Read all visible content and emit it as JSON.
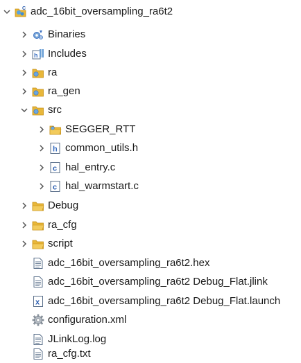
{
  "tree": {
    "root": {
      "label": "adc_16bit_oversampling_ra6t2",
      "icon": "c-project-icon",
      "expanded": true
    },
    "binaries": {
      "label": "Binaries",
      "icon": "binaries-icon"
    },
    "includes": {
      "label": "Includes",
      "icon": "includes-icon"
    },
    "ra": {
      "label": "ra",
      "icon": "source-folder-icon"
    },
    "ra_gen": {
      "label": "ra_gen",
      "icon": "source-folder-icon"
    },
    "src": {
      "label": "src",
      "icon": "source-folder-icon",
      "expanded": true,
      "children": {
        "segger_rtt": {
          "label": "SEGGER_RTT",
          "icon": "source-folder-icon"
        },
        "common_utils_h": {
          "label": "common_utils.h",
          "icon": "h-file-icon"
        },
        "hal_entry_c": {
          "label": "hal_entry.c",
          "icon": "c-file-icon"
        },
        "hal_warmstart_c": {
          "label": "hal_warmstart.c",
          "icon": "c-file-icon"
        }
      }
    },
    "debug": {
      "label": "Debug",
      "icon": "folder-icon"
    },
    "ra_cfg": {
      "label": "ra_cfg",
      "icon": "folder-icon"
    },
    "script": {
      "label": "script",
      "icon": "folder-icon"
    },
    "hex_file": {
      "label": "adc_16bit_oversampling_ra6t2.hex",
      "icon": "text-file-icon"
    },
    "jlink_file": {
      "label": "adc_16bit_oversampling_ra6t2 Debug_Flat.jlink",
      "icon": "text-file-icon"
    },
    "launch_file": {
      "label": "adc_16bit_oversampling_ra6t2 Debug_Flat.launch",
      "icon": "launch-file-icon"
    },
    "config_xml": {
      "label": "configuration.xml",
      "icon": "gear-icon"
    },
    "jlink_log": {
      "label": "JLinkLog.log",
      "icon": "text-file-icon"
    },
    "ra_cfg_txt": {
      "label": "ra_cfg.txt",
      "icon": "text-file-icon"
    }
  },
  "colors": {
    "folder": "#e8b73a",
    "folder_dark": "#c58e12",
    "chevron": "#555555",
    "h_file": "#3a6fc1",
    "c_file": "#2a5db0",
    "launch": "#2a5db0"
  }
}
